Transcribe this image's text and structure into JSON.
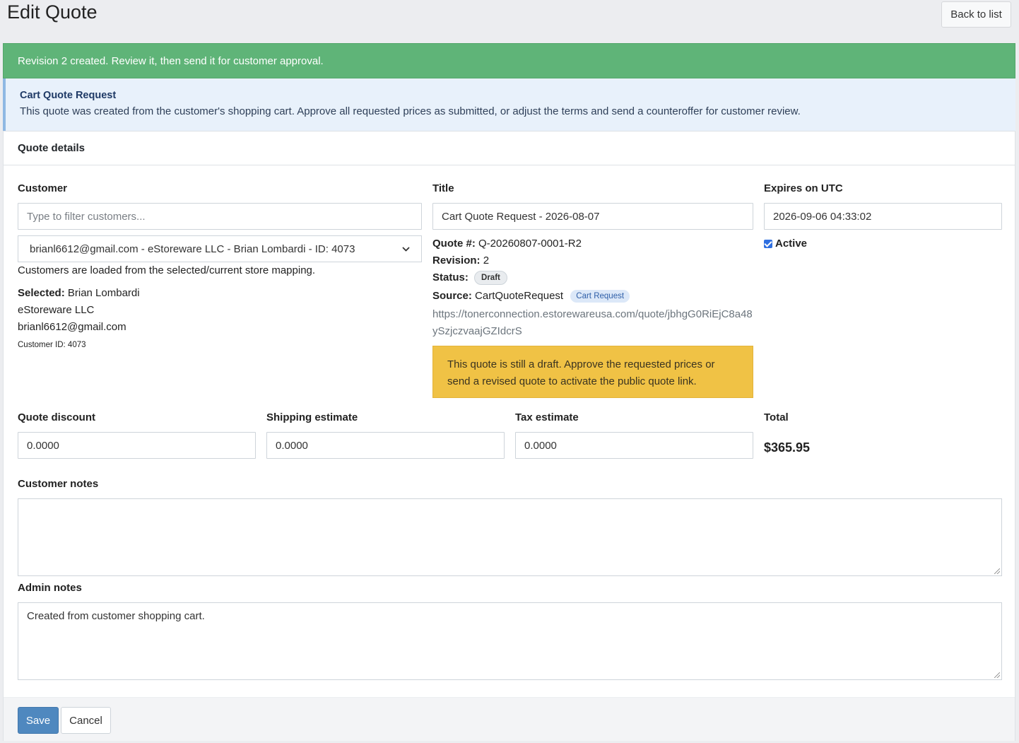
{
  "page": {
    "title": "Edit Quote",
    "back_label": "Back to list"
  },
  "alerts": {
    "success": "Revision 2 created. Review it, then send it for customer approval.",
    "info_title": "Cart Quote Request",
    "info_text": "This quote was created from the customer's shopping cart. Approve all requested prices as submitted, or adjust the terms and send a counteroffer for customer review."
  },
  "card": {
    "header": "Quote details"
  },
  "customer": {
    "label": "Customer",
    "filter_placeholder": "Type to filter customers...",
    "selected_option": "brianl6612@gmail.com - eStoreware LLC - Brian Lombardi - ID: 4073",
    "help": "Customers are loaded from the selected/current store mapping.",
    "selected_label": "Selected:",
    "selected_name": "Brian Lombardi",
    "company": "eStoreware LLC",
    "email": "brianl6612@gmail.com",
    "customer_id": "Customer ID: 4073"
  },
  "title_field": {
    "label": "Title",
    "value": "Cart Quote Request - 2026-08-07"
  },
  "meta": {
    "quote_no_label": "Quote #:",
    "quote_no": "Q-20260807-0001-R2",
    "revision_label": "Revision:",
    "revision": "2",
    "status_label": "Status:",
    "status": "Draft",
    "source_label": "Source:",
    "source": "CartQuoteRequest",
    "source_badge": "Cart Request",
    "link": "https://tonerconnection.estorewareusa.com/quote/jbhgG0RiEjC8a48ySzjczvaajGZIdcrS",
    "warning": "This quote is still a draft. Approve the requested prices or send a revised quote to activate the public quote link."
  },
  "expires": {
    "label": "Expires on UTC",
    "value": "2026-09-06 04:33:02",
    "active_label": "Active",
    "active_checked": true
  },
  "amounts": {
    "discount_label": "Quote discount",
    "discount": "0.0000",
    "shipping_label": "Shipping estimate",
    "shipping": "0.0000",
    "tax_label": "Tax estimate",
    "tax": "0.0000",
    "total_label": "Total",
    "total": "$365.95"
  },
  "notes": {
    "customer_label": "Customer notes",
    "customer_value": "",
    "admin_label": "Admin notes",
    "admin_value": "Created from customer shopping cart."
  },
  "footer": {
    "save_label": "Save",
    "cancel_label": "Cancel"
  },
  "colors": {
    "success": "#5fb478",
    "info_bg": "#e8f1fb",
    "warning": "#f0c245",
    "primary_button": "#4f88bf"
  }
}
